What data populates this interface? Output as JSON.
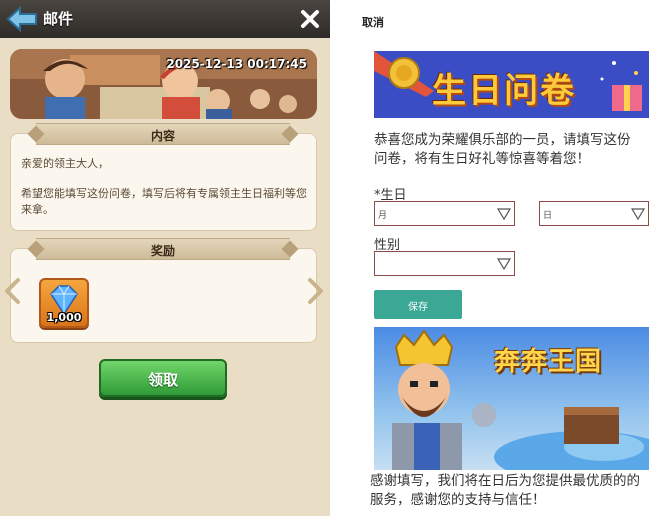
{
  "mail": {
    "title": "邮件",
    "banner_datetime": "2025-12-13 00:17:45",
    "content_section_title": "内容",
    "greeting": "亲爱的领主大人，",
    "message": "希望您能填写这份问卷，填写后将有专属领主生日福利等您来拿。",
    "reward_section_title": "奖励",
    "reward_item": {
      "icon": "diamond-icon",
      "count": "1,000"
    },
    "claim_button": "领取",
    "colors": {
      "header": "#3b3632",
      "panel": "#e9ddc6",
      "claim": "#3fb046",
      "reward_bg": "#e8902e"
    }
  },
  "survey": {
    "cancel": "取消",
    "banner_title": "生日问卷",
    "intro": "恭喜您成为荣耀俱乐部的一员，请填写这份问卷，将有生日好礼等惊喜等着您！",
    "birthday_label": "*生日",
    "month_placeholder": "月",
    "day_placeholder": "日",
    "gender_label": "性别",
    "gender_value": "",
    "save_button": "保存",
    "game_banner_title": "奔奔王国",
    "thanks": "感谢填写，我们将在日后为您提供最优质的的服务，感谢您的支持与信任！",
    "colors": {
      "save": "#3aa895",
      "select_border": "#8a4a46",
      "banner": "#3b4dc4"
    }
  }
}
